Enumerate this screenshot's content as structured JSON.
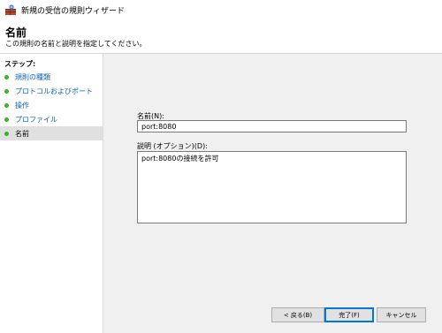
{
  "window": {
    "title": "新規の受信の規則ウィザード"
  },
  "header": {
    "title": "名前",
    "description": "この規則の名前と説明を指定してください。"
  },
  "sidebar": {
    "steps_label": "ステップ:",
    "steps": [
      {
        "label": "規則の種類"
      },
      {
        "label": "プロトコルおよびポート"
      },
      {
        "label": "操作"
      },
      {
        "label": "プロファイル"
      },
      {
        "label": "名前"
      }
    ]
  },
  "form": {
    "name_label": "名前(N):",
    "name_value": "port:8080",
    "desc_label": "説明 (オプション)(D):",
    "desc_value": "port:8080の接続を許可"
  },
  "buttons": {
    "back": "< 戻る(B)",
    "finish": "完了(F)",
    "cancel": "キャンセル"
  },
  "colors": {
    "step_link": "#0b62b5",
    "step_dot": "#3fae2a",
    "primary_border": "#0078d7"
  }
}
